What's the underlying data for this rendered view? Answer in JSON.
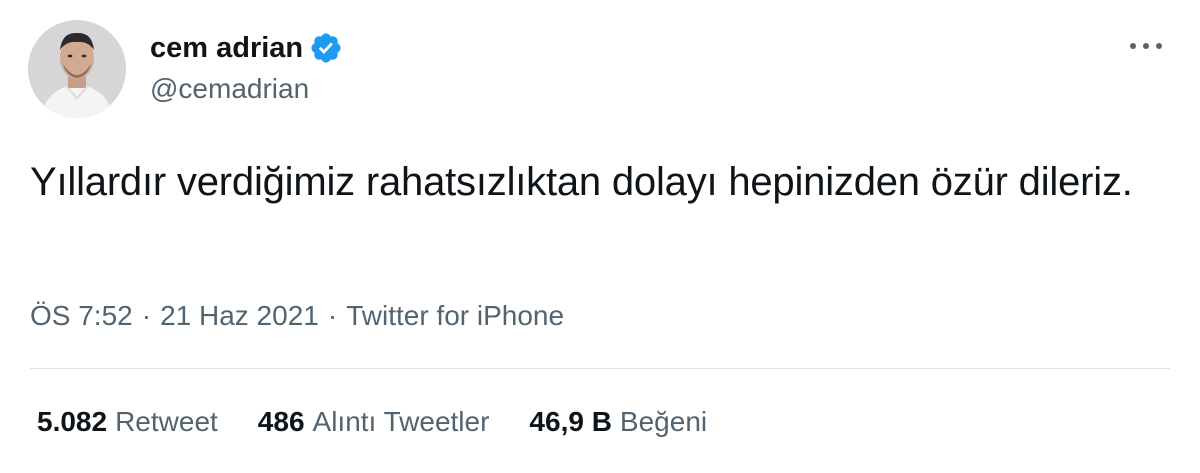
{
  "user": {
    "display_name": "cem adrian",
    "handle": "@cemadrian",
    "verified": true,
    "avatar_icon": "profile-photo"
  },
  "tweet": {
    "text": "Yıllardır verdiğimiz rahatsızlıktan dolayı hepinizden özür dileriz.",
    "time": "ÖS 7:52",
    "date": "21 Haz 2021",
    "source": "Twitter for iPhone",
    "separator": "·"
  },
  "stats": {
    "retweets": {
      "count": "5.082",
      "label": "Retweet"
    },
    "quotes": {
      "count": "486",
      "label": "Alıntı Tweetler"
    },
    "likes": {
      "count": "46,9 B",
      "label": "Beğeni"
    }
  },
  "icons": {
    "verified": "verified-badge-icon",
    "more": "more-horizontal-icon"
  },
  "colors": {
    "text_primary": "#0f1419",
    "text_secondary": "#536471",
    "verified_blue": "#1d9bf0",
    "divider": "#dfe4e8"
  }
}
